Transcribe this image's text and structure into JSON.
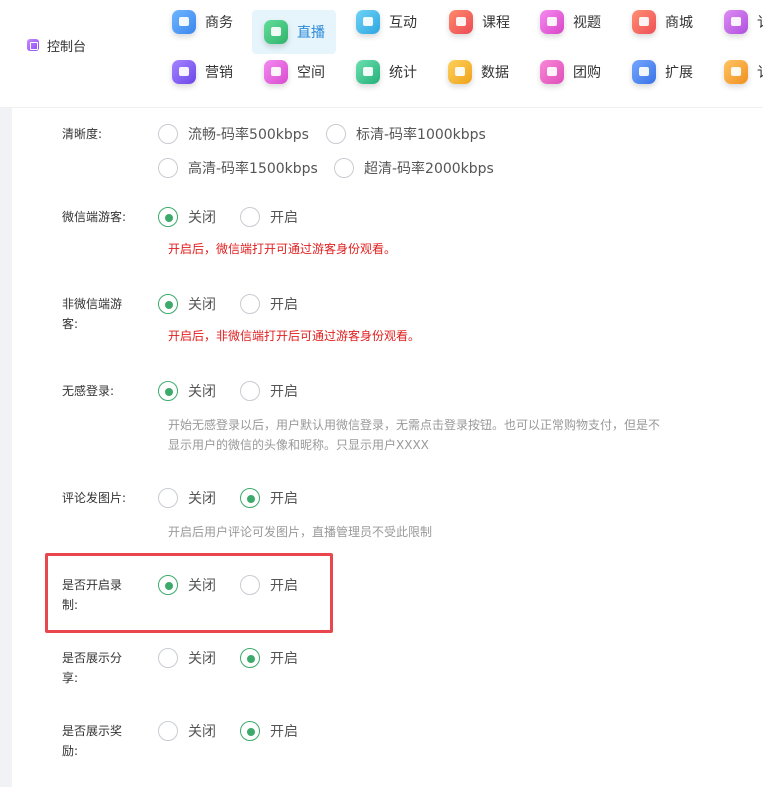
{
  "topnav": {
    "console_label": "控制台",
    "row1": [
      {
        "label": "商务",
        "icon": "briefcase-icon",
        "color": "#4a9cf4"
      },
      {
        "label": "直播",
        "icon": "live-icon",
        "color": "#3dc47a",
        "active": true
      },
      {
        "label": "互动",
        "icon": "chat-icon",
        "color": "#3fb6e8"
      },
      {
        "label": "课程",
        "icon": "course-icon",
        "color": "#f0605a"
      },
      {
        "label": "视题",
        "icon": "video-icon",
        "color": "#e95fd6"
      },
      {
        "label": "商城",
        "icon": "shop-icon",
        "color": "#f46a5a"
      },
      {
        "label": "讠",
        "icon": "settings-icon",
        "color": "#c46be0"
      }
    ],
    "row2": [
      {
        "label": "营销",
        "icon": "marketing-icon",
        "color": "#8a63f2"
      },
      {
        "label": "空间",
        "icon": "space-icon",
        "color": "#e75fdc"
      },
      {
        "label": "统计",
        "icon": "stats-icon",
        "color": "#35c28a"
      },
      {
        "label": "数据",
        "icon": "data-icon",
        "color": "#f2b12f"
      },
      {
        "label": "团购",
        "icon": "groupbuy-icon",
        "color": "#ef62c8"
      },
      {
        "label": "扩展",
        "icon": "extend-icon",
        "color": "#4c86f0"
      },
      {
        "label": "讠",
        "icon": "coupon-icon",
        "color": "#f3a331"
      }
    ]
  },
  "settings": {
    "clarity": {
      "label": "清晰度:",
      "options": [
        "流畅-码率500kbps",
        "标清-码率1000kbps",
        "高清-码率1500kbps",
        "超清-码率2000kbps"
      ]
    },
    "wechat_guest": {
      "label": "微信端游客:",
      "off": "关闭",
      "on": "开启",
      "selected": "off",
      "note": "开启后，微信端打开可通过游客身份观看。"
    },
    "non_wechat_guest": {
      "label": "非微信端游客:",
      "off": "关闭",
      "on": "开启",
      "selected": "off",
      "note": "开启后，非微信端打开后可通过游客身份观看。"
    },
    "silent_login": {
      "label": "无感登录:",
      "off": "关闭",
      "on": "开启",
      "selected": "off",
      "note_line1": "开始无感登录以后，用户默认用微信登录，无需点击登录按钮。也可以正常购物支付，但是不",
      "note_line2": "显示用户的微信的头像和昵称。只显示用户XXXX"
    },
    "comment_image": {
      "label": "评论发图片:",
      "off": "关闭",
      "on": "开启",
      "selected": "on",
      "note": "开启后用户评论可发图片，直播管理员不受此限制"
    },
    "recording": {
      "label": "是否开启录制:",
      "off": "关闭",
      "on": "开启",
      "selected": "off"
    },
    "show_share": {
      "label": "是否展示分享:",
      "off": "关闭",
      "on": "开启",
      "selected": "on"
    },
    "show_reward": {
      "label": "是否展示奖励:",
      "off": "关闭",
      "on": "开启",
      "selected": "on"
    }
  },
  "colors": {
    "accent_green": "#3daa6c",
    "note_red": "#e02020",
    "highlight_red": "#e9464e",
    "active_tab_bg": "#e6f4fb"
  }
}
